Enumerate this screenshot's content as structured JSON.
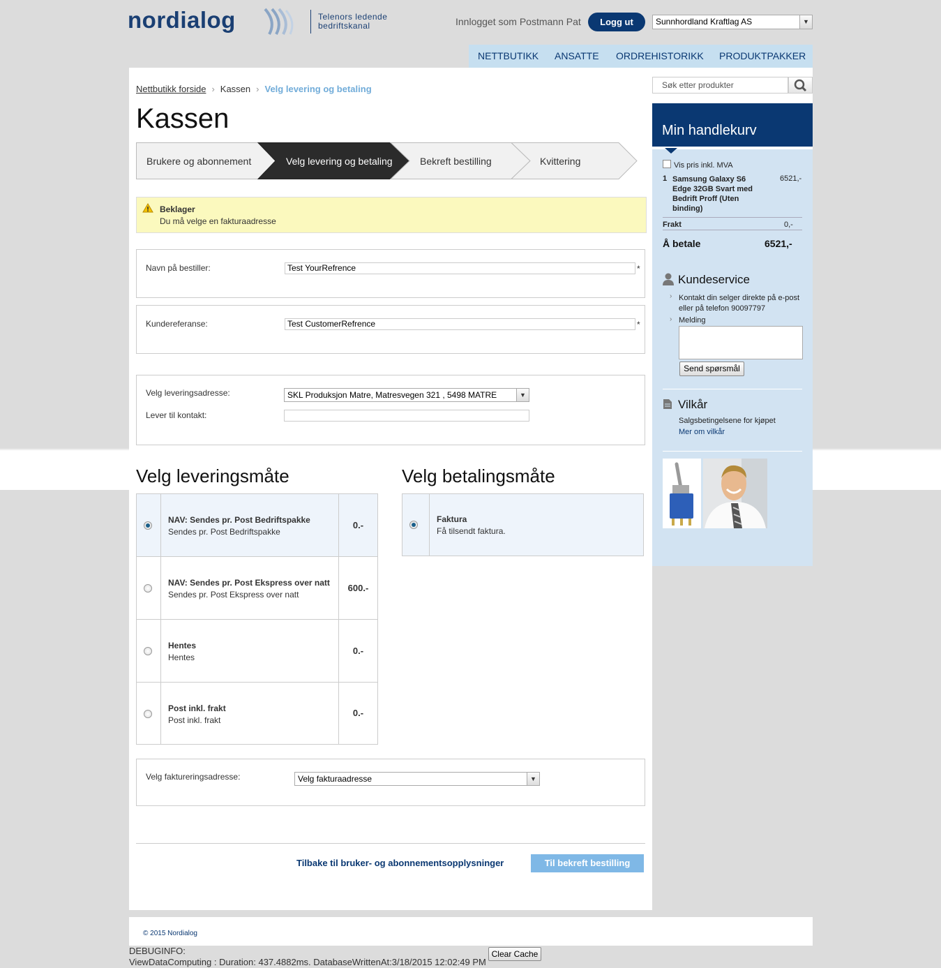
{
  "header": {
    "logo": "nordialog",
    "tagline_line1": "Telenors ledende",
    "tagline_line2": "bedriftskanal",
    "logged_in": "Innlogget som Postmann Pat",
    "logout": "Logg ut",
    "company": "Sunnhordland Kraftlag AS"
  },
  "nav": [
    "NETTBUTIKK",
    "ANSATTE",
    "ORDREHISTORIKK",
    "PRODUKTPAKKER"
  ],
  "breadcrumb": {
    "home": "Nettbutikk forside",
    "mid": "Kassen",
    "current": "Velg levering og betaling"
  },
  "title": "Kassen",
  "steps": [
    "Brukere og abonnement",
    "Velg levering og betaling",
    "Bekreft bestilling",
    "Kvittering"
  ],
  "alert": {
    "title": "Beklager",
    "message": "Du må velge en fakturaadresse"
  },
  "form": {
    "orderer_label": "Navn på bestiller:",
    "orderer_value": "Test YourRefrence",
    "customer_ref_label": "Kundereferanse:",
    "customer_ref_value": "Test CustomerRefrence",
    "required": "*",
    "delivery_addr_label": "Velg leveringsadresse:",
    "delivery_addr_value": "SKL Produksjon Matre, Matresvegen 321 , 5498 MATRE",
    "contact_label": "Lever til kontakt:",
    "contact_value": ""
  },
  "delivery": {
    "heading": "Velg leveringsmåte",
    "options": [
      {
        "name": "NAV: Sendes pr. Post Bedriftspakke",
        "desc": "Sendes pr. Post Bedriftspakke",
        "price": "0.-",
        "selected": true
      },
      {
        "name": "NAV: Sendes pr. Post Ekspress over natt",
        "desc": "Sendes pr. Post Ekspress over natt",
        "price": "600.-",
        "selected": false
      },
      {
        "name": "Hentes",
        "desc": "Hentes",
        "price": "0.-",
        "selected": false
      },
      {
        "name": "Post inkl. frakt",
        "desc": "Post inkl. frakt",
        "price": "0.-",
        "selected": false
      }
    ]
  },
  "payment": {
    "heading": "Velg betalingsmåte",
    "options": [
      {
        "name": "Faktura",
        "desc": "Få tilsendt faktura.",
        "selected": true
      }
    ]
  },
  "billing": {
    "label": "Velg faktureringsadresse:",
    "value": "Velg fakturaadresse"
  },
  "actions": {
    "back": "Tilbake til bruker- og abonnementsopplysninger",
    "next": "Til bekreft bestilling"
  },
  "sidebar": {
    "search_placeholder": "Søk etter produkter",
    "cart_title": "Min handlekurv",
    "vat_label": "Vis pris inkl. MVA",
    "item_qty": "1",
    "item_name_lines": [
      "Samsung Galaxy S6",
      "Edge 32GB Svart med",
      "Bedrift Proff (Uten",
      "binding)"
    ],
    "item_price": "6521,-",
    "shipping_label": "Frakt",
    "shipping_value": "0,-",
    "total_label": "Å betale",
    "total_value": "6521,-",
    "support_title": "Kundeservice",
    "support_line1": "Kontakt din selger direkte på e-post",
    "support_line2": "eller på telefon 90097797",
    "message_label": "Melding",
    "send_button": "Send spørsmål",
    "terms_title": "Vilkår",
    "terms_text": "Salgsbetingelsene for kjøpet",
    "terms_link": "Mer om vilkår"
  },
  "footer": {
    "copyright": "© 2015 Nordialog",
    "debug_title": "DEBUGINFO:",
    "debug_text": "ViewDataComputing : Duration: 437.4882ms. DatabaseWrittenAt:3/18/2015 12:02:49 PM",
    "clear_cache": "Clear Cache"
  },
  "colors": {
    "brand": "#0a3872",
    "nav_bg": "#c6dff0",
    "sidebar_bg": "#d2e3f2",
    "accent_light": "#71acd9",
    "alert_bg": "#fbf9be"
  }
}
